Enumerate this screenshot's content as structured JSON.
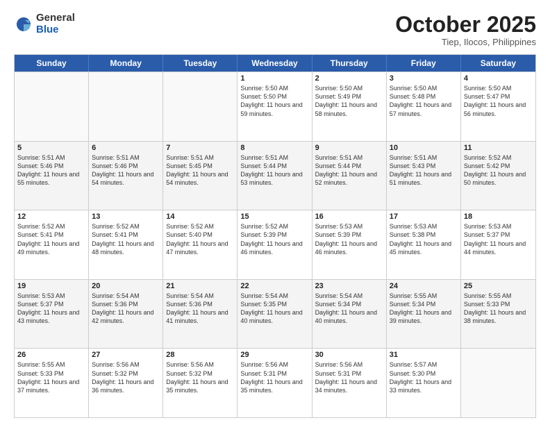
{
  "logo": {
    "general": "General",
    "blue": "Blue"
  },
  "header": {
    "month": "October 2025",
    "location": "Tiep, Ilocos, Philippines"
  },
  "weekdays": [
    "Sunday",
    "Monday",
    "Tuesday",
    "Wednesday",
    "Thursday",
    "Friday",
    "Saturday"
  ],
  "rows": [
    [
      {
        "day": "",
        "sunrise": "",
        "sunset": "",
        "daylight": ""
      },
      {
        "day": "",
        "sunrise": "",
        "sunset": "",
        "daylight": ""
      },
      {
        "day": "",
        "sunrise": "",
        "sunset": "",
        "daylight": ""
      },
      {
        "day": "1",
        "sunrise": "Sunrise: 5:50 AM",
        "sunset": "Sunset: 5:50 PM",
        "daylight": "Daylight: 11 hours and 59 minutes."
      },
      {
        "day": "2",
        "sunrise": "Sunrise: 5:50 AM",
        "sunset": "Sunset: 5:49 PM",
        "daylight": "Daylight: 11 hours and 58 minutes."
      },
      {
        "day": "3",
        "sunrise": "Sunrise: 5:50 AM",
        "sunset": "Sunset: 5:48 PM",
        "daylight": "Daylight: 11 hours and 57 minutes."
      },
      {
        "day": "4",
        "sunrise": "Sunrise: 5:50 AM",
        "sunset": "Sunset: 5:47 PM",
        "daylight": "Daylight: 11 hours and 56 minutes."
      }
    ],
    [
      {
        "day": "5",
        "sunrise": "Sunrise: 5:51 AM",
        "sunset": "Sunset: 5:46 PM",
        "daylight": "Daylight: 11 hours and 55 minutes."
      },
      {
        "day": "6",
        "sunrise": "Sunrise: 5:51 AM",
        "sunset": "Sunset: 5:46 PM",
        "daylight": "Daylight: 11 hours and 54 minutes."
      },
      {
        "day": "7",
        "sunrise": "Sunrise: 5:51 AM",
        "sunset": "Sunset: 5:45 PM",
        "daylight": "Daylight: 11 hours and 54 minutes."
      },
      {
        "day": "8",
        "sunrise": "Sunrise: 5:51 AM",
        "sunset": "Sunset: 5:44 PM",
        "daylight": "Daylight: 11 hours and 53 minutes."
      },
      {
        "day": "9",
        "sunrise": "Sunrise: 5:51 AM",
        "sunset": "Sunset: 5:44 PM",
        "daylight": "Daylight: 11 hours and 52 minutes."
      },
      {
        "day": "10",
        "sunrise": "Sunrise: 5:51 AM",
        "sunset": "Sunset: 5:43 PM",
        "daylight": "Daylight: 11 hours and 51 minutes."
      },
      {
        "day": "11",
        "sunrise": "Sunrise: 5:52 AM",
        "sunset": "Sunset: 5:42 PM",
        "daylight": "Daylight: 11 hours and 50 minutes."
      }
    ],
    [
      {
        "day": "12",
        "sunrise": "Sunrise: 5:52 AM",
        "sunset": "Sunset: 5:41 PM",
        "daylight": "Daylight: 11 hours and 49 minutes."
      },
      {
        "day": "13",
        "sunrise": "Sunrise: 5:52 AM",
        "sunset": "Sunset: 5:41 PM",
        "daylight": "Daylight: 11 hours and 48 minutes."
      },
      {
        "day": "14",
        "sunrise": "Sunrise: 5:52 AM",
        "sunset": "Sunset: 5:40 PM",
        "daylight": "Daylight: 11 hours and 47 minutes."
      },
      {
        "day": "15",
        "sunrise": "Sunrise: 5:52 AM",
        "sunset": "Sunset: 5:39 PM",
        "daylight": "Daylight: 11 hours and 46 minutes."
      },
      {
        "day": "16",
        "sunrise": "Sunrise: 5:53 AM",
        "sunset": "Sunset: 5:39 PM",
        "daylight": "Daylight: 11 hours and 46 minutes."
      },
      {
        "day": "17",
        "sunrise": "Sunrise: 5:53 AM",
        "sunset": "Sunset: 5:38 PM",
        "daylight": "Daylight: 11 hours and 45 minutes."
      },
      {
        "day": "18",
        "sunrise": "Sunrise: 5:53 AM",
        "sunset": "Sunset: 5:37 PM",
        "daylight": "Daylight: 11 hours and 44 minutes."
      }
    ],
    [
      {
        "day": "19",
        "sunrise": "Sunrise: 5:53 AM",
        "sunset": "Sunset: 5:37 PM",
        "daylight": "Daylight: 11 hours and 43 minutes."
      },
      {
        "day": "20",
        "sunrise": "Sunrise: 5:54 AM",
        "sunset": "Sunset: 5:36 PM",
        "daylight": "Daylight: 11 hours and 42 minutes."
      },
      {
        "day": "21",
        "sunrise": "Sunrise: 5:54 AM",
        "sunset": "Sunset: 5:36 PM",
        "daylight": "Daylight: 11 hours and 41 minutes."
      },
      {
        "day": "22",
        "sunrise": "Sunrise: 5:54 AM",
        "sunset": "Sunset: 5:35 PM",
        "daylight": "Daylight: 11 hours and 40 minutes."
      },
      {
        "day": "23",
        "sunrise": "Sunrise: 5:54 AM",
        "sunset": "Sunset: 5:34 PM",
        "daylight": "Daylight: 11 hours and 40 minutes."
      },
      {
        "day": "24",
        "sunrise": "Sunrise: 5:55 AM",
        "sunset": "Sunset: 5:34 PM",
        "daylight": "Daylight: 11 hours and 39 minutes."
      },
      {
        "day": "25",
        "sunrise": "Sunrise: 5:55 AM",
        "sunset": "Sunset: 5:33 PM",
        "daylight": "Daylight: 11 hours and 38 minutes."
      }
    ],
    [
      {
        "day": "26",
        "sunrise": "Sunrise: 5:55 AM",
        "sunset": "Sunset: 5:33 PM",
        "daylight": "Daylight: 11 hours and 37 minutes."
      },
      {
        "day": "27",
        "sunrise": "Sunrise: 5:56 AM",
        "sunset": "Sunset: 5:32 PM",
        "daylight": "Daylight: 11 hours and 36 minutes."
      },
      {
        "day": "28",
        "sunrise": "Sunrise: 5:56 AM",
        "sunset": "Sunset: 5:32 PM",
        "daylight": "Daylight: 11 hours and 35 minutes."
      },
      {
        "day": "29",
        "sunrise": "Sunrise: 5:56 AM",
        "sunset": "Sunset: 5:31 PM",
        "daylight": "Daylight: 11 hours and 35 minutes."
      },
      {
        "day": "30",
        "sunrise": "Sunrise: 5:56 AM",
        "sunset": "Sunset: 5:31 PM",
        "daylight": "Daylight: 11 hours and 34 minutes."
      },
      {
        "day": "31",
        "sunrise": "Sunrise: 5:57 AM",
        "sunset": "Sunset: 5:30 PM",
        "daylight": "Daylight: 11 hours and 33 minutes."
      },
      {
        "day": "",
        "sunrise": "",
        "sunset": "",
        "daylight": ""
      }
    ]
  ]
}
